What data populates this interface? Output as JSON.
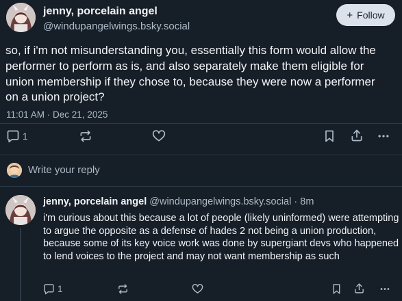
{
  "post": {
    "author_name": "jenny, porcelain angel",
    "author_handle": "@windupangelwings.bsky.social",
    "follow_label": "Follow",
    "text": "so, if i'm not misunderstanding you, essentially this form would allow the performer to perform as is, and also separately make them eligible for union membership if they chose to, because they were now a performer on a union project?",
    "timestamp": "11:01 AM · Dec 21, 2025",
    "reply_count": "1"
  },
  "reply_bar": {
    "placeholder": "Write your reply"
  },
  "reply": {
    "author_name": "jenny, porcelain angel",
    "author_handle": "@windupangelwings.bsky.social",
    "separator": "·",
    "age": "8m",
    "text": "i'm curious about this because a lot of people (likely uninformed) were attempting to argue the opposite as a defense of hades 2 not being a union production, because some of its key voice work was done by supergiant devs who happened to lend voices to the project and may not want membership as such",
    "reply_count": "1"
  },
  "icons": {
    "reply": "speech-bubble-icon",
    "repost": "repost-arrows-icon",
    "like": "heart-icon",
    "bookmark": "bookmark-icon",
    "share": "share-upload-icon",
    "more": "ellipsis-icon"
  },
  "colors": {
    "background": "#161e27",
    "text_primary": "#f1f3f5",
    "text_secondary": "#aebbc9",
    "follow_button": "#dce2ea",
    "divider": "#2c3947"
  }
}
